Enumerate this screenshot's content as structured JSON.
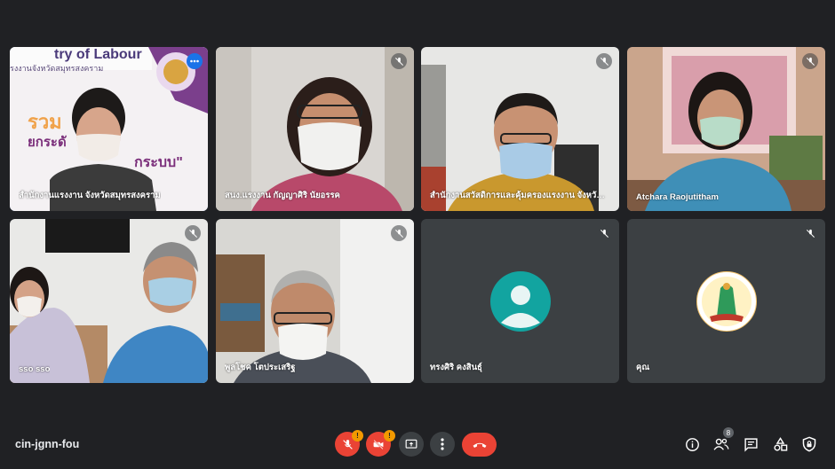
{
  "meeting": {
    "code": "cin-jgnn-fou"
  },
  "banner": {
    "text": "try of Labour",
    "subtitle": "รงงานจังหวัดสมุทรสงคราม",
    "line1": "รวม",
    "line2": "ยกระดั",
    "line3": "กระบบ\""
  },
  "participants": [
    {
      "name": "สำนักงานแรงงาน จังหวัดสมุทรสงคราม",
      "muted": false,
      "active": true
    },
    {
      "name": "สนง.แรงงาน กัญญาศิริ นัยอรรค",
      "muted": true
    },
    {
      "name": "สำนักงานสวัสดิการและคุ้มครองแรงงาน จังหวัดส...",
      "muted": true
    },
    {
      "name": "Atchara Raojutitham",
      "muted": true
    },
    {
      "name": "sso sso",
      "muted": true
    },
    {
      "name": "พูลโชค โตประเสริฐ",
      "muted": true
    },
    {
      "name": "ทรงศิริ คงสินธุ์",
      "muted": true,
      "avatar": "person"
    },
    {
      "name": "คุณ",
      "muted": true,
      "avatar": "emblem"
    }
  ],
  "controls": {
    "mic_badge": "!",
    "cam_badge": "!",
    "participant_count": "8"
  },
  "colors": {
    "background": "#202124",
    "accent": "#8ab4f8",
    "danger": "#ea4335",
    "warning": "#f29900",
    "avatar_teal": "#12a4a0"
  }
}
